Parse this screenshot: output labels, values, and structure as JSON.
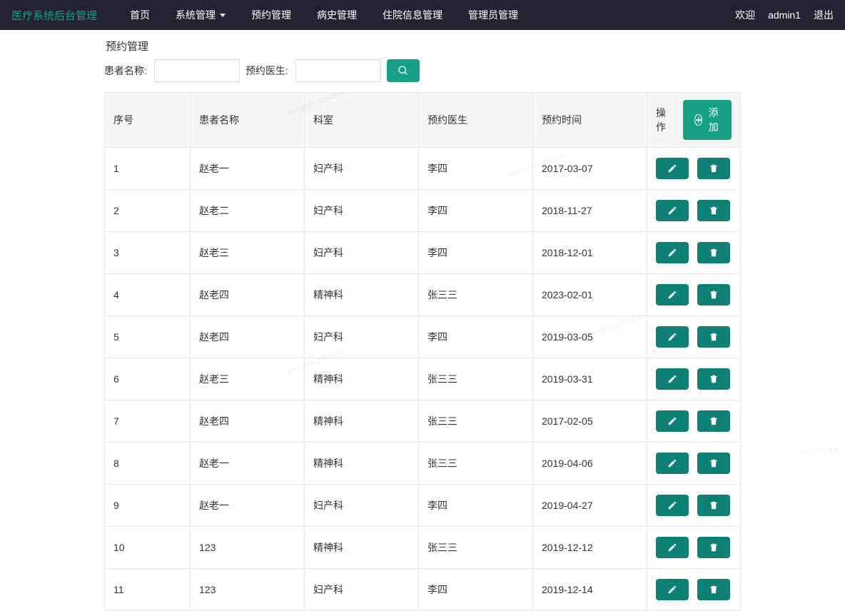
{
  "brand": "医疗系统后台管理",
  "nav": {
    "items": [
      "首页",
      "系统管理",
      "预约管理",
      "病史管理",
      "住院信息管理",
      "管理员管理"
    ],
    "dropdown_index": 1
  },
  "nav_right": {
    "welcome": "欢迎",
    "username": "admin1",
    "logout": "退出"
  },
  "page_title": "预约管理",
  "search": {
    "patient_label": "患者名称:",
    "patient_value": "",
    "doctor_label": "预约医生:",
    "doctor_value": ""
  },
  "columns": {
    "seq": "序号",
    "patient": "患者名称",
    "dept": "科室",
    "doctor": "预约医生",
    "time": "预约时间",
    "ops": "操作",
    "add": "添加"
  },
  "rows": [
    {
      "seq": "1",
      "patient": "赵老一",
      "dept": "妇产科",
      "doctor": "李四",
      "time": "2017-03-07"
    },
    {
      "seq": "2",
      "patient": "赵老二",
      "dept": "妇产科",
      "doctor": "李四",
      "time": "2018-11-27"
    },
    {
      "seq": "3",
      "patient": "赵老三",
      "dept": "妇产科",
      "doctor": "李四",
      "time": "2018-12-01"
    },
    {
      "seq": "4",
      "patient": "赵老四",
      "dept": "精神科",
      "doctor": "张三三",
      "time": "2023-02-01"
    },
    {
      "seq": "5",
      "patient": "赵老四",
      "dept": "妇产科",
      "doctor": "李四",
      "time": "2019-03-05"
    },
    {
      "seq": "6",
      "patient": "赵老三",
      "dept": "精神科",
      "doctor": "张三三",
      "time": "2019-03-31"
    },
    {
      "seq": "7",
      "patient": "赵老四",
      "dept": "精神科",
      "doctor": "张三三",
      "time": "2017-02-05"
    },
    {
      "seq": "8",
      "patient": "赵老一",
      "dept": "精神科",
      "doctor": "张三三",
      "time": "2019-04-06"
    },
    {
      "seq": "9",
      "patient": "赵老一",
      "dept": "妇产科",
      "doctor": "李四",
      "time": "2019-04-27"
    },
    {
      "seq": "10",
      "patient": "123",
      "dept": "精神科",
      "doctor": "张三三",
      "time": "2019-12-12"
    },
    {
      "seq": "11",
      "patient": "123",
      "dept": "妇产科",
      "doctor": "李四",
      "time": "2019-12-14"
    }
  ],
  "watermarks": [
    "javayms.github.io",
    "javayms.github.io",
    "javayms.github.io",
    "javayms.github.io",
    "@51CTO博客"
  ]
}
